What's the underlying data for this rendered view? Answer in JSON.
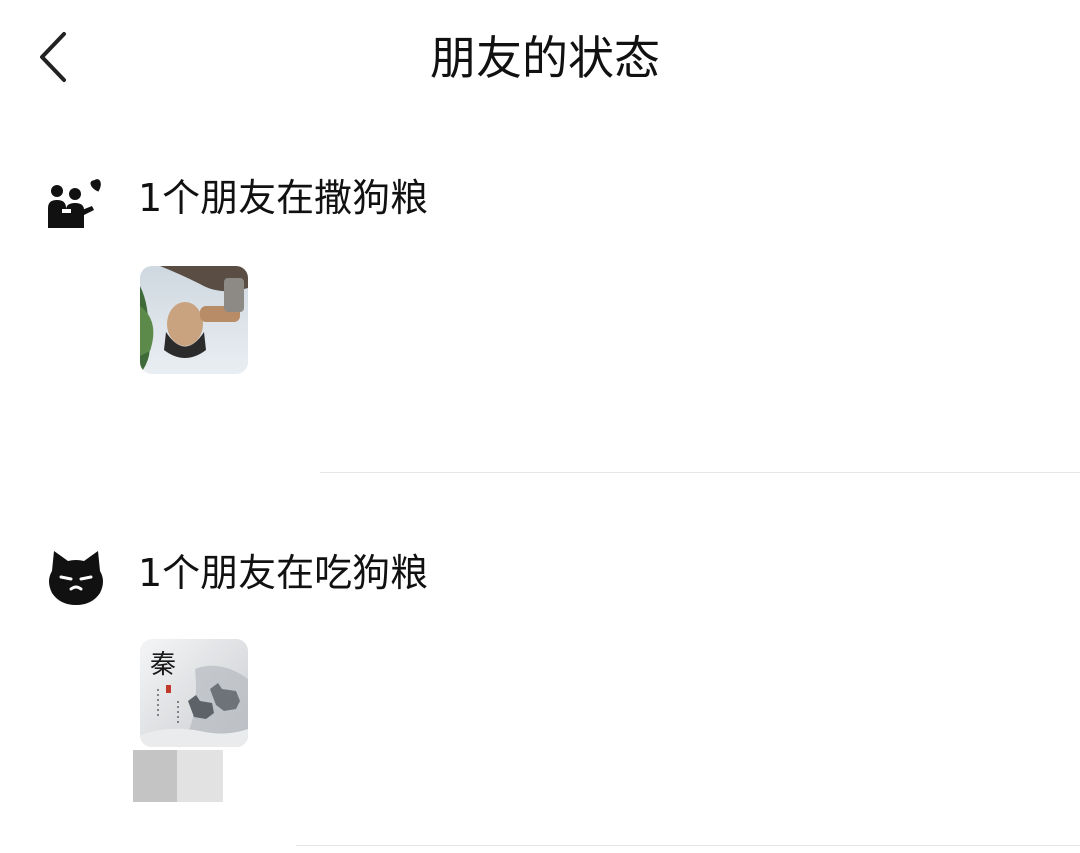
{
  "header": {
    "title": "朋友的状态",
    "back_icon": "chevron-left-icon"
  },
  "sections": [
    {
      "icon": "couple-heart-icon",
      "title": "1个朋友在撒狗粮",
      "friends": [
        {
          "avatar": "friend-avatar-photo"
        }
      ]
    },
    {
      "icon": "cat-face-icon",
      "title": "1个朋友在吃狗粮",
      "friends": [
        {
          "avatar": "friend-avatar-wolf-painting",
          "avatar_text": "秦"
        }
      ]
    }
  ],
  "colors": {
    "text": "#111111",
    "divider": "#e6e6e6",
    "background": "#ffffff"
  }
}
